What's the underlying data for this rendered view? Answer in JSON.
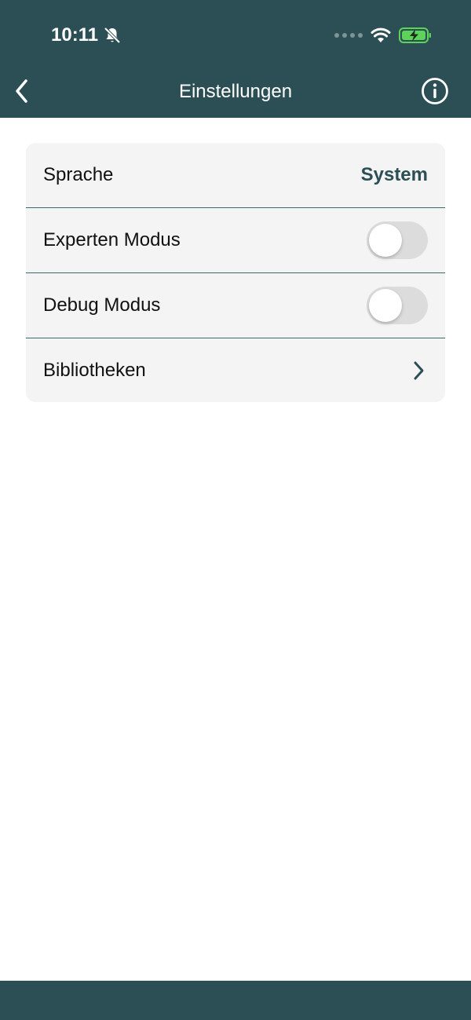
{
  "status_bar": {
    "time": "10:11",
    "icons": [
      "bell-slash-icon",
      "signal-dots-icon",
      "wifi-icon",
      "battery-charging-icon"
    ]
  },
  "header": {
    "title": "Einstellungen",
    "back_icon": "chevron-left-icon",
    "info_icon": "info-circle-icon"
  },
  "settings": {
    "language": {
      "label": "Sprache",
      "value": "System"
    },
    "expert_mode": {
      "label": "Experten Modus",
      "enabled": false
    },
    "debug_mode": {
      "label": "Debug Modus",
      "enabled": false
    },
    "libraries": {
      "label": "Bibliotheken",
      "icon": "chevron-right-icon"
    }
  },
  "colors": {
    "primary": "#2b4f55",
    "card_background": "#f4f4f4",
    "battery": "#5ed35a"
  }
}
